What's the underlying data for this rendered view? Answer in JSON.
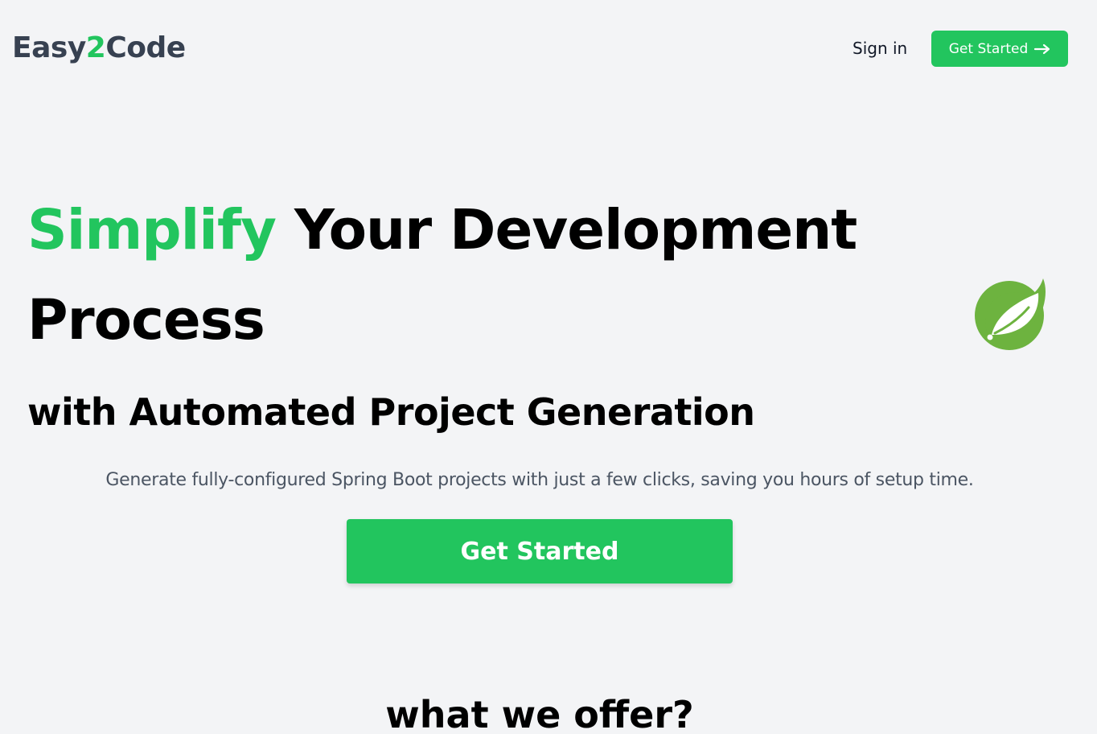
{
  "header": {
    "logo_prefix": "Easy",
    "logo_accent": "2",
    "logo_suffix": "Code",
    "signin_label": "Sign in",
    "cta_label": "Get Started",
    "cta_icon": "arrow-right-icon"
  },
  "hero": {
    "title_accent": "Simplify",
    "title_rest": "Your Development",
    "title_line2": "Process",
    "subtitle": "with Automated Project Generation",
    "description": "Generate fully-configured Spring Boot projects with just a few clicks, saving you hours of setup time.",
    "cta_label": "Get Started",
    "logo_icon": "spring-leaf-icon"
  },
  "offer": {
    "title": "what we offer?"
  },
  "colors": {
    "accent": "#22c55e",
    "background": "#f3f4f6",
    "logo_text": "#374151",
    "description_text": "#4b5563",
    "spring_green": "#6db33f"
  }
}
